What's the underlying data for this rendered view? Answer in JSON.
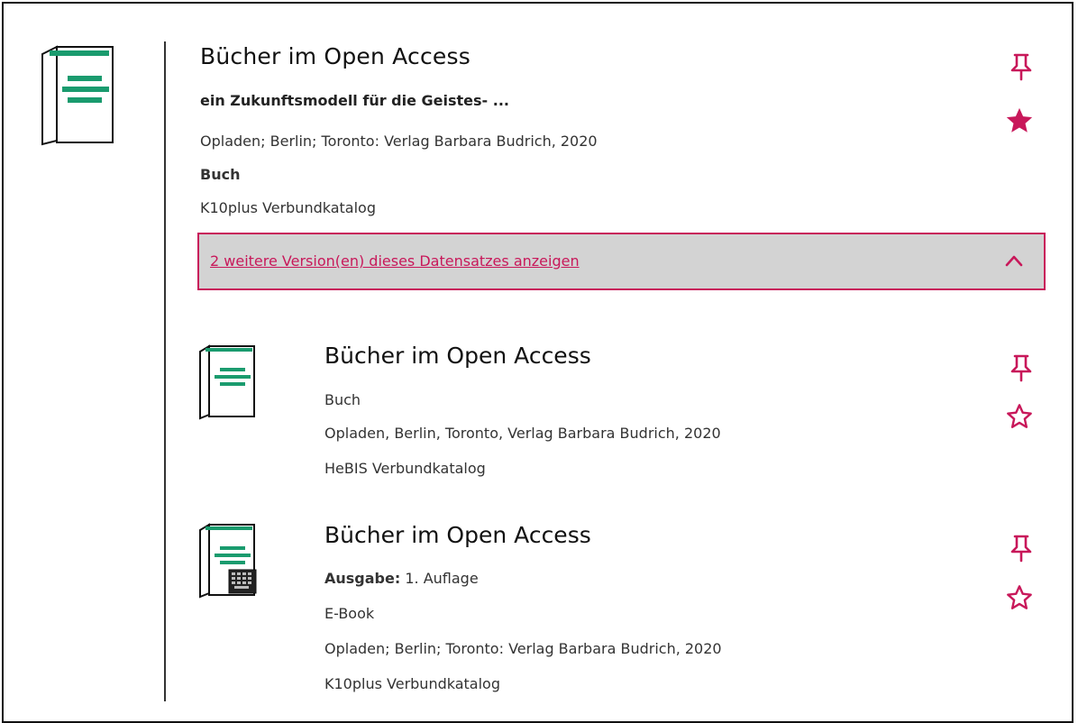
{
  "record": {
    "title": "Bücher im Open Access",
    "subtitle": "ein Zukunftsmodell für die Geistes- ...",
    "publication": "Opladen; Berlin; Toronto: Verlag Barbara Budrich, 2020",
    "type": "Buch",
    "source": "K10plus Verbundkatalog",
    "icon": "book-icon",
    "actions": {
      "pin_icon": "pushpin-icon",
      "favorite_icon": "star-filled-icon"
    }
  },
  "versions_toggle": {
    "label": "2 weitere Version(en) dieses Datensatzes anzeigen",
    "icon": "chevron-up-icon"
  },
  "versions": [
    {
      "title": "Bücher im Open Access",
      "type": "Buch",
      "publication": "Opladen, Berlin, Toronto, Verlag Barbara Budrich, 2020",
      "source": "HeBIS Verbundkatalog",
      "icon": "book-icon"
    },
    {
      "title": "Bücher im Open Access",
      "edition_label": "Ausgabe:",
      "edition_value": " 1. Auflage",
      "type": "E-Book",
      "publication": "Opladen; Berlin; Toronto: Verlag Barbara Budrich, 2020",
      "source": "K10plus Verbundkatalog",
      "icon": "ebook-icon"
    }
  ],
  "colors": {
    "accent": "#c8185a",
    "book_green": "#1a9b6e",
    "bar_bg": "#d3d3d3"
  }
}
